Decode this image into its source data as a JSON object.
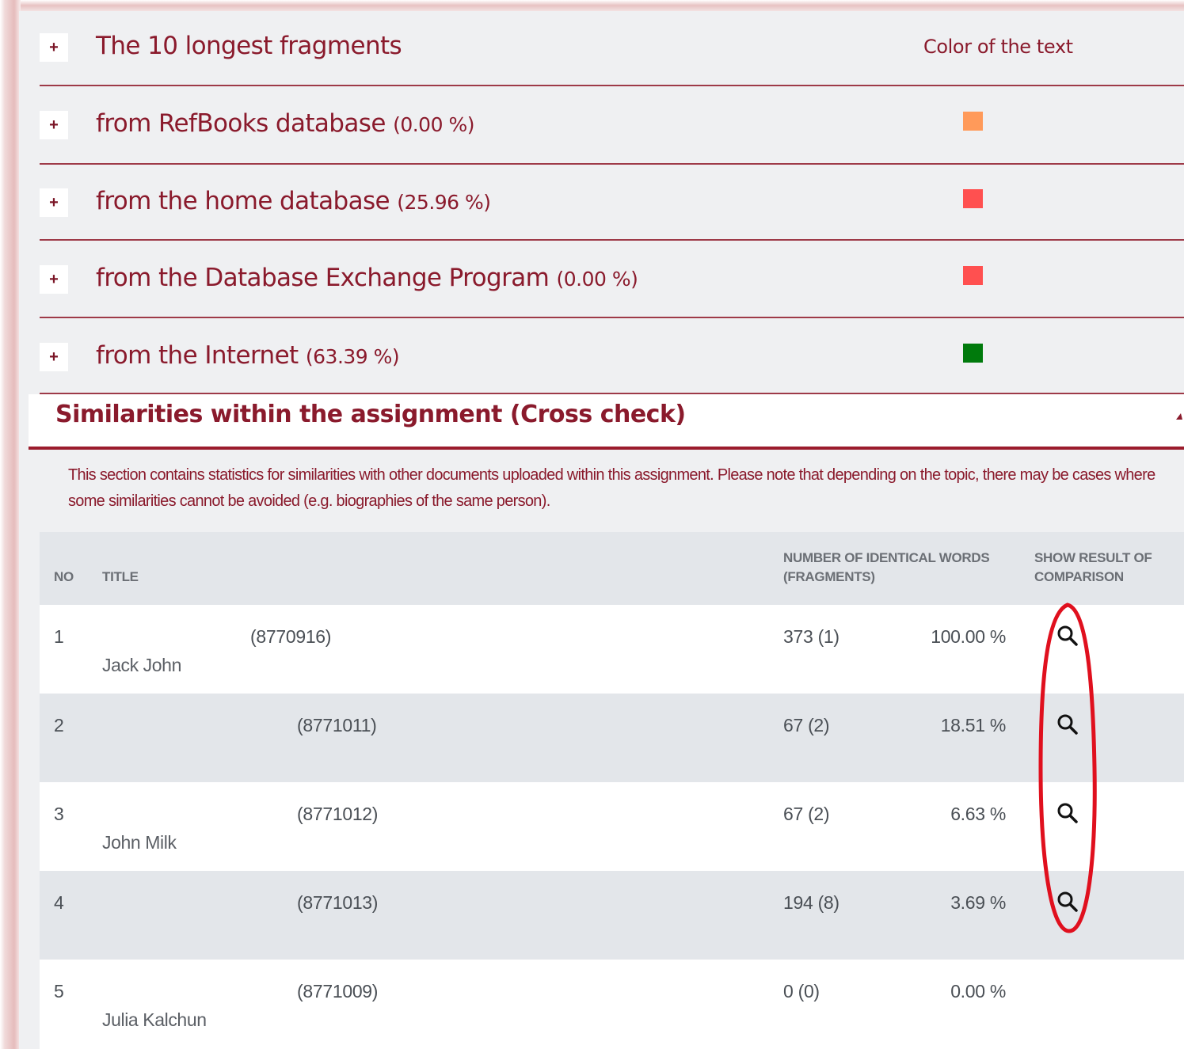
{
  "fragments": {
    "header": {
      "title": "The 10 longest fragments",
      "color_heading": "Color of the text",
      "expand_label": "+"
    },
    "rows": [
      {
        "label": "from RefBooks database",
        "percent": "(0.00 %)",
        "color": "#ff9a5a",
        "expand_label": "+"
      },
      {
        "label": "from the home database",
        "percent": "(25.96 %)",
        "color": "#ff5050",
        "expand_label": "+"
      },
      {
        "label": "from the Database Exchange Program",
        "percent": "(0.00 %)",
        "color": "#ff5050",
        "expand_label": "+"
      },
      {
        "label": "from the Internet",
        "percent": "(63.39 %)",
        "color": "#007a0c",
        "expand_label": "+"
      }
    ]
  },
  "cross_check": {
    "title": "Similarities within the assignment (Cross check)",
    "description": "This section contains statistics for similarities with other documents uploaded within this assignment. Please note that depending on the topic, there may be cases where some similarities cannot be avoided (e.g. biographies of the same person).",
    "table": {
      "headers": {
        "no": "NO",
        "title": "TITLE",
        "words_line1": "NUMBER OF IDENTICAL WORDS",
        "words_line2": "(FRAGMENTS)",
        "show_line1": "SHOW RESULT OF",
        "show_line2": "COMPARISON"
      },
      "rows": [
        {
          "no": "1",
          "id": "(8770916)",
          "author": "Jack John",
          "words": "373 (1)",
          "percent": "100.00 %",
          "has_compare": true
        },
        {
          "no": "2",
          "id": "(8771011)",
          "author": "",
          "words": "67 (2)",
          "percent": "18.51 %",
          "has_compare": true
        },
        {
          "no": "3",
          "id": "(8771012)",
          "author": "John Milk",
          "words": "67 (2)",
          "percent": "6.63 %",
          "has_compare": true
        },
        {
          "no": "4",
          "id": "(8771013)",
          "author": "",
          "words": "194 (8)",
          "percent": "3.69 %",
          "has_compare": true
        },
        {
          "no": "5",
          "id": "(8771009)",
          "author": "Julia Kalchun",
          "words": "0 (0)",
          "percent": "0.00 %",
          "has_compare": false
        }
      ]
    }
  },
  "annotation": {
    "highlight_color": "#e0101e"
  }
}
